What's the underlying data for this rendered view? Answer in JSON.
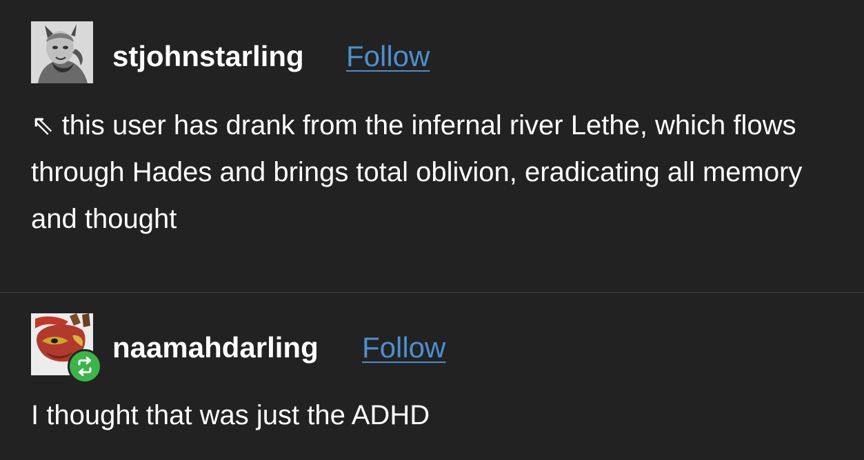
{
  "posts": [
    {
      "username": "stjohnstarling",
      "follow_label": "Follow",
      "body": "⇖ this user has drank from the infernal river Lethe, which flows through Hades and brings total oblivion, eradicating all memory and thought",
      "avatar_icon": "avatar-engraving-icon"
    },
    {
      "username": "naamahdarling",
      "follow_label": "Follow",
      "body": "I thought that was just the ADHD",
      "avatar_icon": "avatar-mask-icon",
      "badge_icon": "reblog-icon"
    }
  ],
  "colors": {
    "background": "#222222",
    "text": "#ffffff",
    "link": "#4e8fd0",
    "reblog_badge": "#3bb54a",
    "divider": "#3c3c3c"
  }
}
